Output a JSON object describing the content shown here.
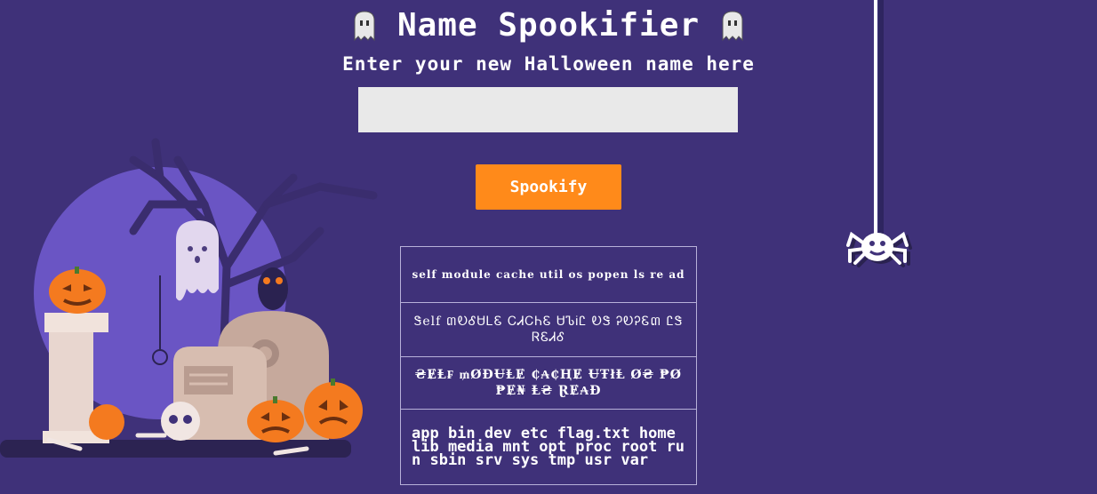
{
  "header": {
    "title": "Name Spookifier",
    "subtitle": "Enter your new Halloween name here",
    "title_icon": "ghost-icon"
  },
  "form": {
    "input_value": "",
    "input_placeholder": "",
    "button_label": "Spookify"
  },
  "results": [
    "self module cache util os popen ls re ad",
    "Ꮥelf ៣ᎧᎴᏌᏞᏋ ᏟᏗᏟᏂᏋ ᏌᏖᎥᏝ ᎧᏕ ᎮᎧᎮᏋ៣ ᏝᏕ ᏒᏋᏗᎴ",
    "₴ɆⱠ₣ ₥ØĐɄⱠɆ ₵₳₵ⱧɆ ɄŦłⱠ Ø₴ ₱Ø₱Ɇ₦ Ⱡ₴ ⱤɆ₳Đ",
    "app bin dev etc flag.txt home lib media mnt opt proc root run sbin srv sys tmp usr var"
  ],
  "colors": {
    "background": "#3f3179",
    "button": "#ff8a1a",
    "input": "#e9e9e9",
    "moon": "#6a55c4",
    "pumpkin": "#f47a1f"
  },
  "decor": {
    "scene": "halloween-graveyard-illustration",
    "spider": "spider-icon"
  }
}
